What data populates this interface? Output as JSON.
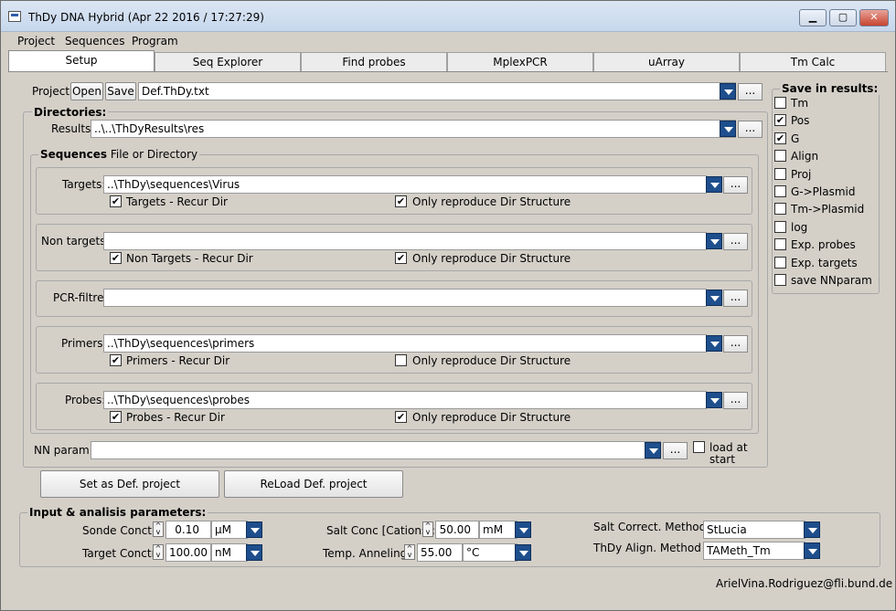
{
  "window": {
    "title": "ThDy DNA Hybrid (Apr 22 2016 / 17:27:29)",
    "min": "▁",
    "max": "▢",
    "close": "✕"
  },
  "menu": [
    "Project",
    "Sequences",
    "Program"
  ],
  "tabs": [
    "Setup",
    "Seq Explorer",
    "Find probes",
    "MplexPCR",
    "uArray",
    "Tm Calc"
  ],
  "project": {
    "label": "Project:",
    "open": "Open",
    "save": "Save",
    "value": "Def.ThDy.txt"
  },
  "dirs": {
    "title": "Directories:",
    "results_label": "Results:",
    "results_value": "..\\..\\ThDyResults\\res"
  },
  "seqs": {
    "title": "Sequences",
    "subtitle": "File or Directory"
  },
  "targets": {
    "label": "Targets:",
    "value": "..\\ThDy\\sequences\\Virus",
    "recur": "Targets - Recur Dir",
    "only": "Only reproduce Dir Structure",
    "recur_checked": "✔",
    "only_checked": "✔"
  },
  "nontargets": {
    "label": "Non targets:",
    "value": "",
    "recur": "Non Targets - Recur Dir",
    "only": "Only reproduce Dir Structure",
    "recur_checked": "✔",
    "only_checked": "✔"
  },
  "pcr": {
    "label": "PCR-filtre:",
    "value": ""
  },
  "primers": {
    "label": "Primers:",
    "value": "..\\ThDy\\sequences\\primers",
    "recur": "Primers - Recur Dir",
    "only": "Only reproduce Dir Structure",
    "recur_checked": "✔",
    "only_checked": ""
  },
  "probes": {
    "label": "Probes:",
    "value": "..\\ThDy\\sequences\\probes",
    "recur": "Probes - Recur Dir",
    "only": "Only reproduce Dir Structure",
    "recur_checked": "✔",
    "only_checked": "✔"
  },
  "nn": {
    "label": "NN param:",
    "value": "",
    "load": "load at start",
    "load_checked": ""
  },
  "buttons": {
    "setdef": "Set as Def. project",
    "reload": "ReLoad Def. project",
    "dots": "..."
  },
  "save_results": {
    "title": "Save in results:",
    "items": [
      {
        "label": "Tm",
        "checked": ""
      },
      {
        "label": "Pos",
        "checked": "✔"
      },
      {
        "label": "G",
        "checked": "✔"
      },
      {
        "label": "Align",
        "checked": ""
      },
      {
        "label": "Proj",
        "checked": ""
      },
      {
        "label": "G->Plasmid",
        "checked": ""
      },
      {
        "label": "Tm->Plasmid",
        "checked": ""
      },
      {
        "label": "log",
        "checked": ""
      },
      {
        "label": "Exp. probes",
        "checked": ""
      },
      {
        "label": "Exp. targets",
        "checked": ""
      },
      {
        "label": "save NNparam",
        "checked": ""
      }
    ]
  },
  "params": {
    "title": "Input & analisis parameters:",
    "sonde": {
      "label": "Sonde Conctr:",
      "value": "0.10",
      "unit": "µM"
    },
    "target": {
      "label": "Target Conctr:",
      "value": "100.00",
      "unit": "nM"
    },
    "salt": {
      "label": "Salt Conc [Cations]:",
      "value": "50.00",
      "unit": "mM"
    },
    "temp": {
      "label": "Temp. Anneling:",
      "value": "55.00",
      "unit": "°C"
    },
    "saltcorr": {
      "label": "Salt Correct. Method:",
      "value": "StLucia"
    },
    "align": {
      "label": "ThDy Align. Method",
      "value": "TAMeth_Tm"
    }
  },
  "footer": "ArielVina.Rodriguez@fli.bund.de"
}
